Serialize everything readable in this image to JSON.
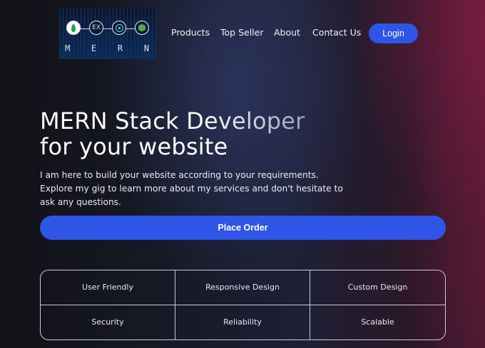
{
  "logo": {
    "node_label": "EX",
    "letters": [
      "M",
      "E",
      "R",
      "N"
    ],
    "icons": [
      "mongodb-leaf-icon",
      "express-icon",
      "react-atom-icon",
      "nodejs-hex-icon"
    ]
  },
  "nav": {
    "products": "Products",
    "top_seller": "Top Seller",
    "about": "About",
    "contact": "Contact Us",
    "login": "Login"
  },
  "hero": {
    "title_line1": "MERN Stack Developer",
    "title_line2": "for your website",
    "description": "I am here to build your website according to your requirements. Explore my gig to learn more about my services and don't hesitate to ask any questions.",
    "cta": "Place Order"
  },
  "features": [
    "User Friendly",
    "Responsive Design",
    "Custom Design",
    "Security",
    "Reliability",
    "Scalable"
  ],
  "colors": {
    "accent": "#2e55e6",
    "border": "#c9ccd6"
  }
}
